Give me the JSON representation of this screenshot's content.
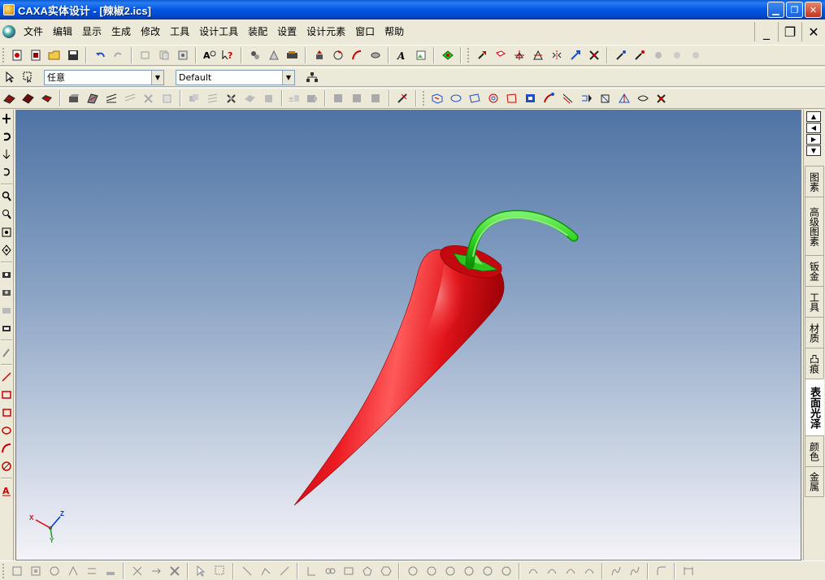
{
  "window": {
    "title": "CAXA实体设计 - [辣椒2.ics]",
    "minimize_symbol": "▁",
    "restore_symbol": "❐",
    "close_symbol": "✕"
  },
  "menu": {
    "items": [
      "文件",
      "编辑",
      "显示",
      "生成",
      "修改",
      "工具",
      "设计工具",
      "装配",
      "设置",
      "设计元素",
      "窗口",
      "帮助"
    ],
    "mdi_minimize": "_",
    "mdi_restore": "❐",
    "mdi_close": "✕"
  },
  "selection_bar": {
    "filter_value": "任意",
    "style_value": "Default"
  },
  "right_panel": {
    "tabs": [
      "图素",
      "高级图素",
      "钣金",
      "工具",
      "材质",
      "凸痕",
      "表面光泽",
      "颜色",
      "金属"
    ],
    "active_tab": "表面光泽"
  },
  "triad": {
    "x_label": "X",
    "y_label": "Y",
    "z_label": "Z"
  },
  "colors": {
    "pepper_body": "#e3121a",
    "pepper_stem": "#2fd41f",
    "viewport_top": "#4f74a5",
    "viewport_bottom": "#f4f3f8",
    "titlebar": "#0055e5"
  }
}
